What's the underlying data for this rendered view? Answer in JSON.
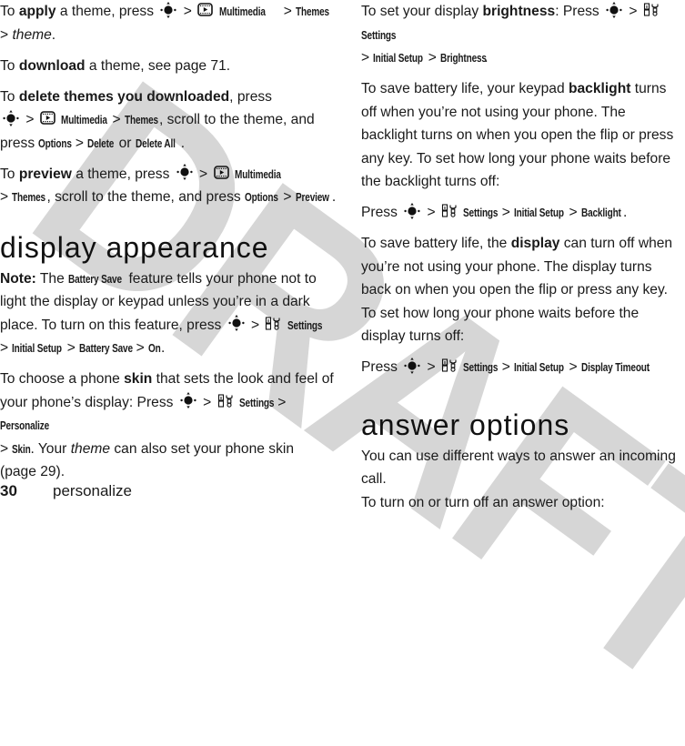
{
  "watermark": "DRAFT",
  "icons": {
    "nav_key": "nav-key-icon",
    "multimedia": "multimedia-icon",
    "settings": "settings-icon"
  },
  "sep": ">",
  "left": {
    "apply": {
      "pre": "To ",
      "kw": "apply",
      "mid": " a theme, press ",
      "menu": [
        "Multimedia",
        "Themes"
      ],
      "last": "theme",
      "end": "."
    },
    "download": {
      "pre": "To ",
      "kw": "download",
      "post": " a theme, see page 71."
    },
    "delete": {
      "pre": "To ",
      "kw": "delete themes you downloaded",
      "mid": ", press",
      "menu": [
        "Multimedia",
        "Themes"
      ],
      "post": ", scroll to the theme, and",
      "press": "press ",
      "options": "Options",
      "delete": "Delete",
      "or": " or ",
      "delete_all": "Delete All",
      "end": "."
    },
    "preview": {
      "pre": "To ",
      "kw": "preview",
      "mid": " a theme, press ",
      "menu": [
        "Multimedia",
        "Themes"
      ],
      "post": ", scroll to the theme, and press ",
      "options": "Options",
      "preview": "Preview",
      "end": "."
    },
    "heading": "display appearance",
    "note": {
      "label": "Note:",
      "t1": " The ",
      "battery_save": "Battery Save",
      "t2": " feature tells your phone not to light the display or keypad unless you’re in a dark place. To turn on this feature, press ",
      "menu": [
        "Settings",
        "Initial Setup",
        "Battery Save",
        "On"
      ],
      "end": "."
    },
    "skin": {
      "pre": "To choose a phone ",
      "kw": "skin",
      "mid": " that sets the look and feel of your phone’s display: Press ",
      "menu": [
        "Settings",
        "Personalize",
        "Skin"
      ],
      "t1": ". Your ",
      "theme": "theme",
      "t2": " can also set your phone skin",
      "t3": "(page 29)."
    }
  },
  "right": {
    "brightness": {
      "pre": "To set your display ",
      "kw": "brightness",
      "mid": ": Press ",
      "menu": [
        "Settings",
        "Initial Setup",
        "Brightness"
      ],
      "end": "."
    },
    "backlight": {
      "pre": "To save battery life, your keypad ",
      "kw": "backlight",
      "post": " turns off when you’re not using your phone. The backlight turns on when you open the flip or press any key. To set how long your phone waits before the backlight turns off:"
    },
    "backlight_press": {
      "pre": "Press ",
      "menu": [
        "Settings",
        "Initial Setup",
        "Backlight"
      ],
      "end": "."
    },
    "display": {
      "pre": "To save battery life, the ",
      "kw": "display",
      "post": " can turn off when you’re not using your phone. The display turns back on when you open the flip or press any key. To set how long your phone waits before the display turns off:"
    },
    "display_press": {
      "pre": "Press ",
      "menu": [
        "Settings",
        "Initial Setup",
        "Display Timeout"
      ],
      "end": "."
    },
    "heading": "answer options",
    "answer": {
      "l1": "You can use different ways to answer an incoming call.",
      "l2": "To turn on or turn off an answer option:"
    }
  },
  "footer": {
    "page_number": "30",
    "section": "personalize"
  }
}
